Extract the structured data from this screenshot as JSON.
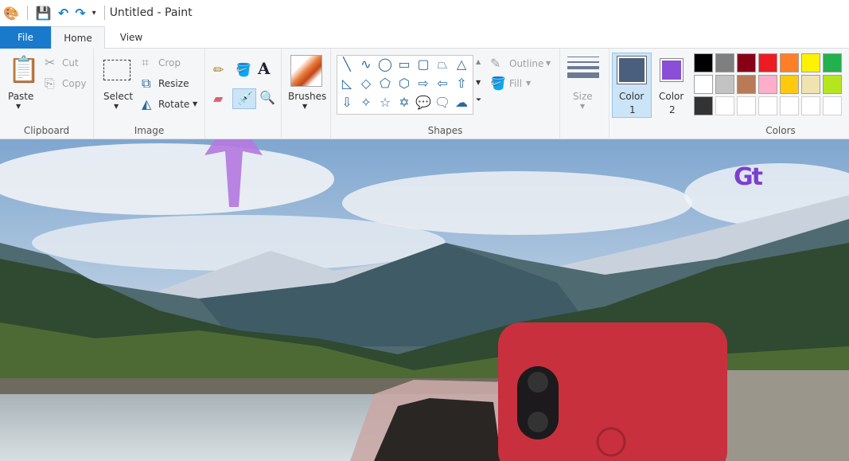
{
  "title": "Untitled - Paint",
  "tabs": [
    "File",
    "Home",
    "View"
  ],
  "clipboard": {
    "paste": "Paste",
    "cut": "Cut",
    "copy": "Copy",
    "label": "Clipboard"
  },
  "image": {
    "select": "Select",
    "crop": "Crop",
    "resize": "Resize",
    "rotate": "Rotate",
    "label": "Image"
  },
  "brushes": "Brushes",
  "shapes": {
    "outline": "Outline",
    "fill": "Fill",
    "label": "Shapes",
    "glyphs": [
      "╲",
      "∿",
      "◯",
      "▭",
      "▢",
      "⏢",
      "△",
      "◺",
      "◇",
      "⬠",
      "⬡",
      "⇨",
      "⇦",
      "⇧",
      "⇩",
      "✧",
      "☆",
      "✡",
      "💬",
      "🗨",
      "☁"
    ]
  },
  "size": "Size",
  "colors": {
    "color1": "Color",
    "color1_num": "1",
    "color2": "Color",
    "color2_num": "2",
    "label": "Colors",
    "color1_value": "#4a5f7e",
    "color2_value": "#8a4fd6",
    "palette": [
      "#000000",
      "#7f7f7f",
      "#880015",
      "#ed1c24",
      "#ff7f27",
      "#fff200",
      "#22b14c",
      "#ffffff",
      "#c3c3c3",
      "#b97a57",
      "#ffaec9",
      "#ffc90e",
      "#efe4b0",
      "#b5e61d",
      "#333333",
      "",
      "",
      "",
      "",
      "",
      ""
    ]
  },
  "accent": "#1979ca",
  "logo": "Gt"
}
